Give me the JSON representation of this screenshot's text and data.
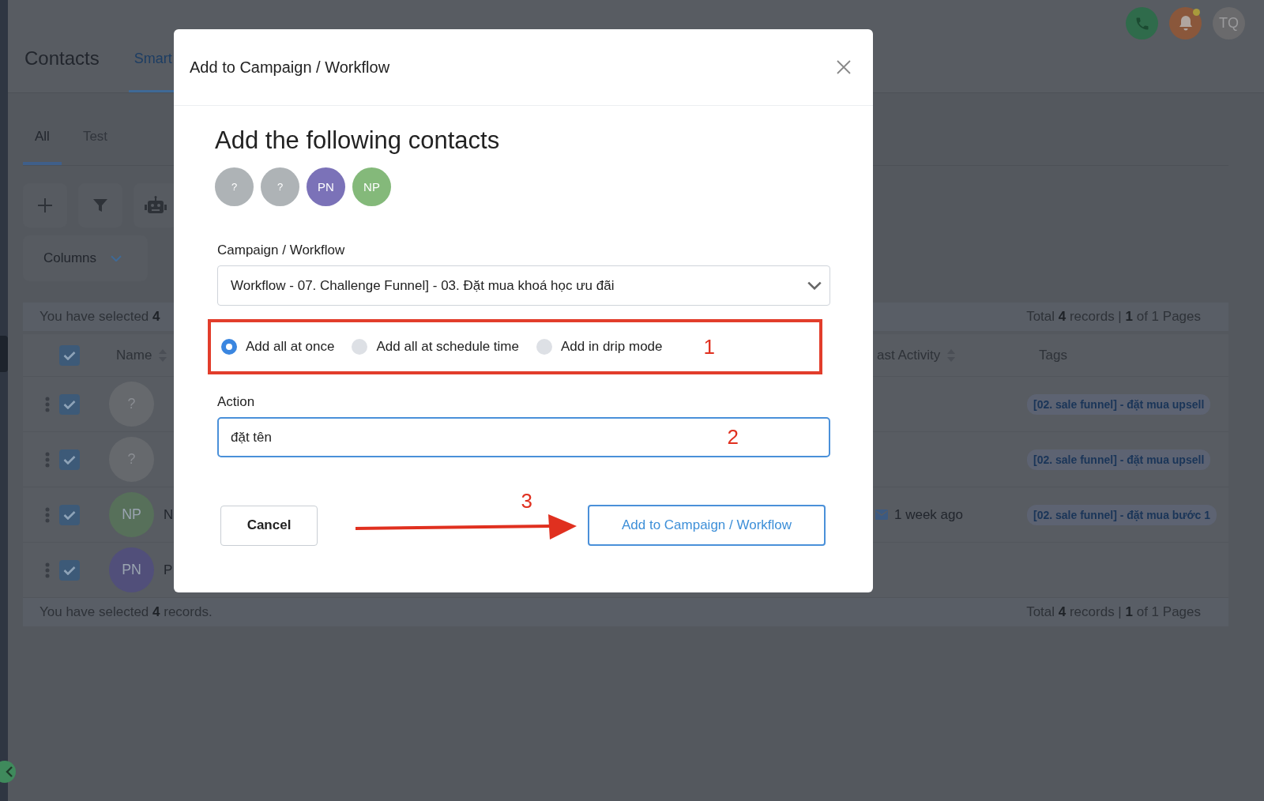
{
  "header": {
    "title": "Contacts",
    "tabs": [
      {
        "label": "Smart",
        "selected": true
      }
    ],
    "user_initials": "TQ",
    "has_notification": true
  },
  "list_tabs": [
    {
      "label": "All",
      "selected": true
    },
    {
      "label": "Test",
      "selected": false
    }
  ],
  "columns_button": "Columns",
  "selection_top": {
    "text": "You have selected **4**",
    "total": "Total **4** records | **1** of 1 Pages"
  },
  "table": {
    "all_checked": true,
    "columns": [
      "Name",
      "ast Activity",
      "Tags"
    ],
    "rows": [
      {
        "checked": true,
        "initials": "?",
        "color": "#66696d",
        "tag": "[02. sale funnel] - đặt mua upsell"
      },
      {
        "checked": true,
        "initials": "?",
        "color": "#66696d",
        "tag": "[02. sale funnel] - đặt mua upsell"
      },
      {
        "checked": true,
        "initials": "NP",
        "color": "#57705a",
        "name": "N",
        "last_activity": "1 week ago",
        "tag": "[02. sale funnel] - đặt mua bước 1"
      },
      {
        "checked": true,
        "initials": "PN",
        "color": "#514f7a",
        "name": "P"
      }
    ]
  },
  "selection_bottom": {
    "text": "You have selected **4** records.",
    "total": "Total **4** records | **1** of 1 Pages"
  },
  "modal": {
    "title": "Add to Campaign / Workflow",
    "heading": "Add the following contacts",
    "contacts": [
      {
        "initials": "?",
        "color": "#aeb3b6"
      },
      {
        "initials": "?",
        "color": "#aeb3b6"
      },
      {
        "initials": "PN",
        "color": "#7b72b8"
      },
      {
        "initials": "NP",
        "color": "#84b97a"
      }
    ],
    "campaign_label": "Campaign / Workflow",
    "campaign_value": "Workflow - 07. Challenge Funnel] - 03. Đặt mua khoá học ưu đãi",
    "modes": [
      {
        "label": "Add all at once",
        "selected": true
      },
      {
        "label": "Add all at schedule time",
        "selected": false
      },
      {
        "label": "Add in drip mode",
        "selected": false
      }
    ],
    "action_label": "Action",
    "action_value": "đặt tên",
    "cancel": "Cancel",
    "submit": "Add to Campaign / Workflow",
    "annotations": [
      "1",
      "2",
      "3"
    ]
  }
}
